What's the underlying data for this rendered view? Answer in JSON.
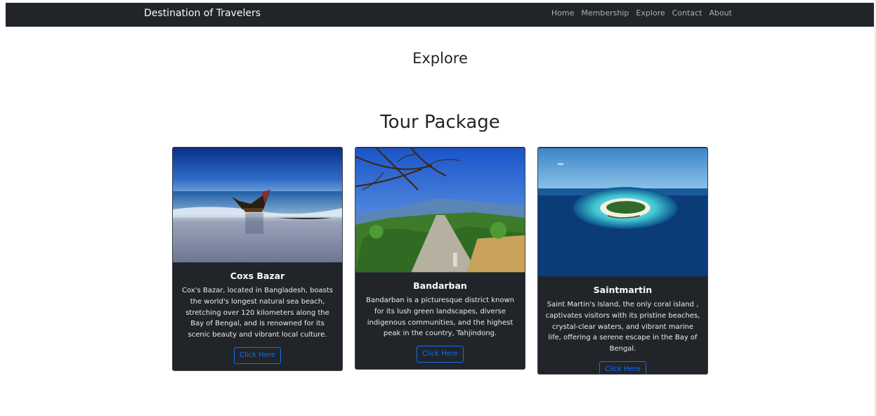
{
  "navbar": {
    "brand": "Destination of Travelers",
    "links": [
      "Home",
      "Membership",
      "Explore",
      "Contact",
      "About"
    ]
  },
  "page": {
    "heading": "Explore",
    "section_heading": "Tour Package"
  },
  "cards": [
    {
      "title": "Coxs Bazar",
      "text": "Cox's Bazar, located in Bangladesh, boasts the world's longest natural sea beach, stretching over 120 kilometers along the Bay of Bengal, and is renowned for its scenic beauty and vibrant local culture.",
      "button": "Click Here"
    },
    {
      "title": "Bandarban",
      "text": "Bandarban is a picturesque district known for its lush green landscapes, diverse indigenous communities, and the highest peak in the country, Tahjindong.",
      "button": "Click Here"
    },
    {
      "title": "Saintmartin",
      "text": "Saint Martin's Island, the only coral island , captivates visitors with its pristine beaches, crystal-clear waters, and vibrant marine life, offering a serene escape in the Bay of Bengal.",
      "button": "Click Here"
    }
  ],
  "colors": {
    "navbar_bg": "#212529",
    "card_bg": "#212529",
    "button_accent": "#0d6efd"
  }
}
